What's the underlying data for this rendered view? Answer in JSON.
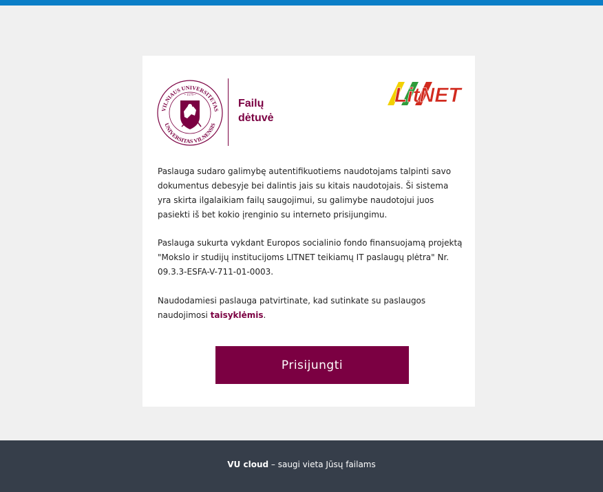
{
  "header": {
    "accent_color": "#0b7ec7"
  },
  "logo": {
    "seal_text_top": "VILNIAUS UNIVERSITETAS",
    "seal_year": "• 1579 •",
    "seal_text_bottom": "UNIVERSITAS VILNENSIS",
    "title_line1": "Failų",
    "title_line2": "dėtuvė",
    "partner_logo_text": "LitNET",
    "brand_color": "#7b0042"
  },
  "content": {
    "paragraph1": "Paslauga sudaro galimybę autentifikuotiems naudotojams talpinti savo dokumentus debesyje bei dalintis jais su kitais naudotojais. Ši sistema yra skirta ilgalaikiam failų saugojimui, su galimybe naudotojui juos pasiekti iš bet kokio įrenginio su interneto prisijungimu.",
    "paragraph2": "Paslauga sukurta vykdant Europos socialinio fondo finansuojamą projektą \"Mokslo ir studijų institucijoms LITNET teikiamų IT paslaugų plėtra\" Nr. 09.3.3-ESFA-V-711-01-0003.",
    "paragraph3_prefix": "Naudodamiesi paslauga patvirtinate, kad sutinkate su paslaugos naudojimosi ",
    "rules_link": "taisyklėmis",
    "paragraph3_suffix": "."
  },
  "login_button": "Prisijungti",
  "footer": {
    "brand": "VU cloud",
    "tagline": " – saugi vieta Jūsų failams",
    "background_color": "#363e4a"
  }
}
